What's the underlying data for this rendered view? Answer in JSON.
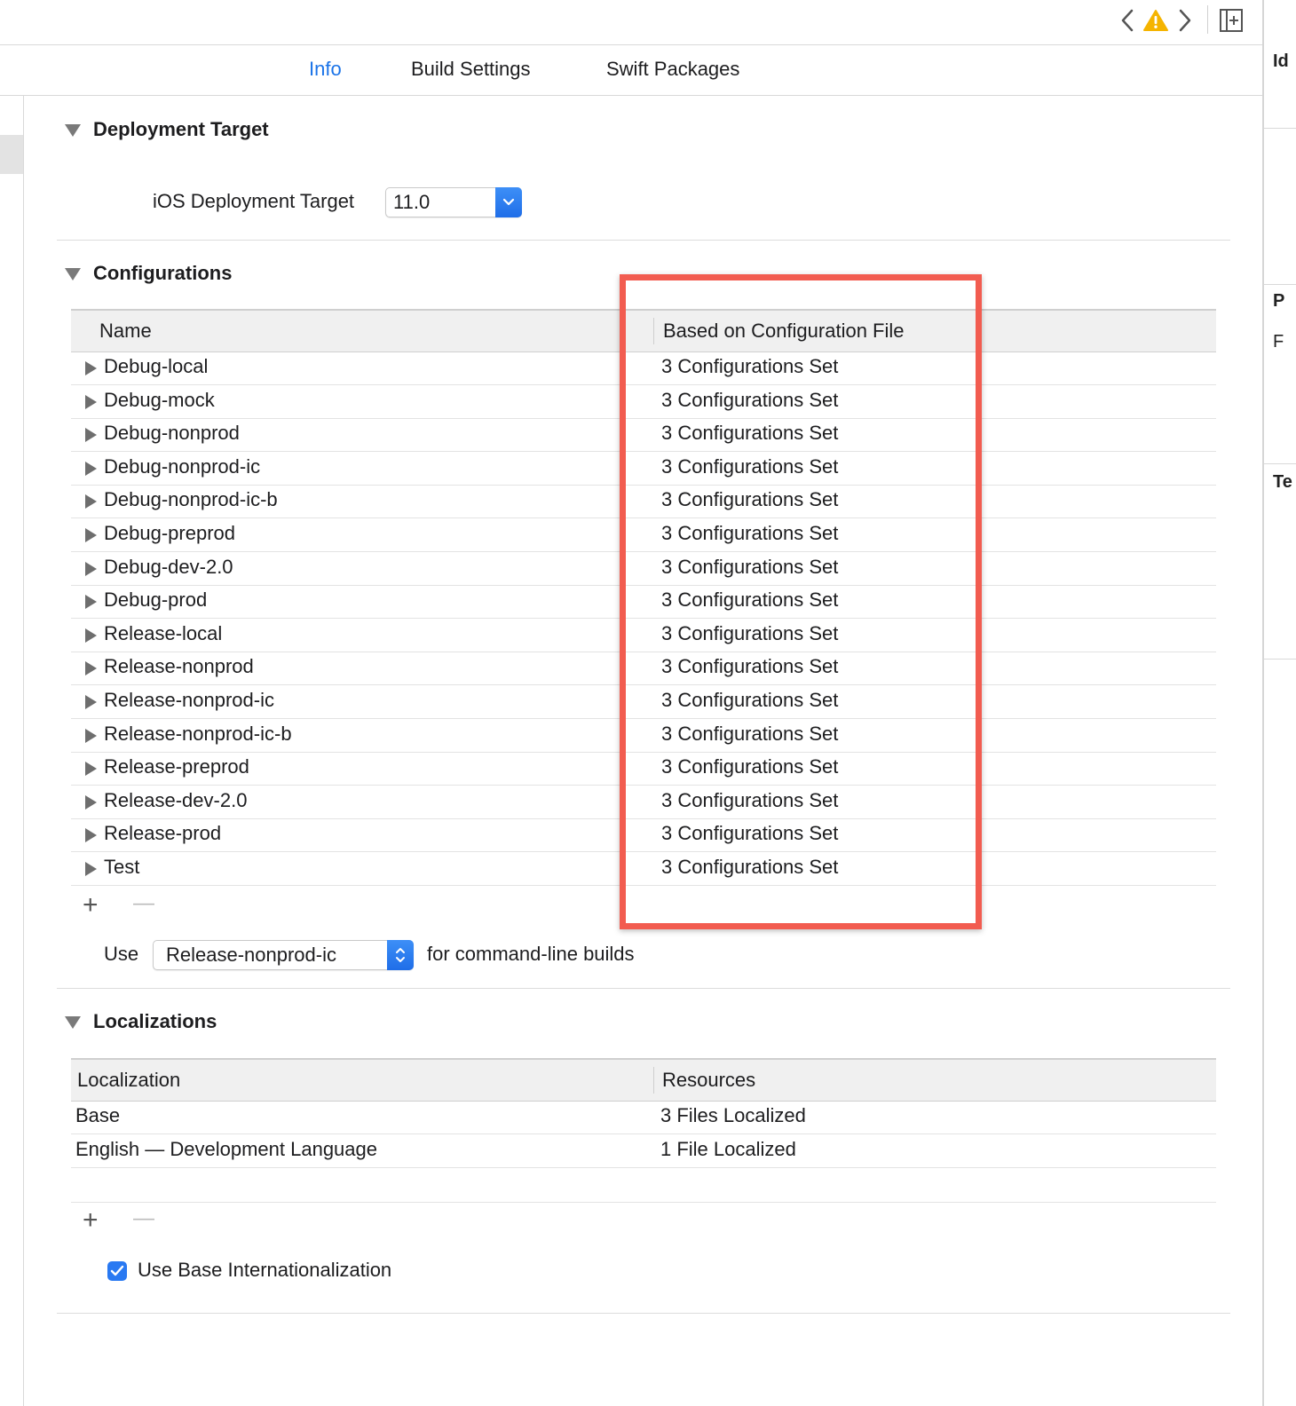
{
  "toolbar": {
    "back_icon": "chevron-left-icon",
    "warning_icon": "warning-icon",
    "forward_icon": "chevron-right-icon",
    "add_editor_icon": "add-editor-icon",
    "warning_color": "#f5b400"
  },
  "tabs": [
    {
      "label": "Info",
      "active": true
    },
    {
      "label": "Build Settings",
      "active": false
    },
    {
      "label": "Swift Packages",
      "active": false
    }
  ],
  "right_panel": {
    "text_1": "Id",
    "text_2": "P",
    "text_3": "F",
    "text_4": "Te"
  },
  "deployment": {
    "title": "Deployment Target",
    "label": "iOS Deployment Target",
    "value": "11.0"
  },
  "configurations": {
    "title": "Configurations",
    "col_name": "Name",
    "col_file": "Based on Configuration File",
    "rows": [
      {
        "name": "Debug-local",
        "file": "3 Configurations Set"
      },
      {
        "name": "Debug-mock",
        "file": "3 Configurations Set"
      },
      {
        "name": "Debug-nonprod",
        "file": "3 Configurations Set"
      },
      {
        "name": "Debug-nonprod-ic",
        "file": "3 Configurations Set"
      },
      {
        "name": "Debug-nonprod-ic-b",
        "file": "3 Configurations Set"
      },
      {
        "name": "Debug-preprod",
        "file": "3 Configurations Set"
      },
      {
        "name": "Debug-dev-2.0",
        "file": "3 Configurations Set"
      },
      {
        "name": "Debug-prod",
        "file": "3 Configurations Set"
      },
      {
        "name": "Release-local",
        "file": "3 Configurations Set"
      },
      {
        "name": "Release-nonprod",
        "file": "3 Configurations Set"
      },
      {
        "name": "Release-nonprod-ic",
        "file": "3 Configurations Set"
      },
      {
        "name": "Release-nonprod-ic-b",
        "file": "3 Configurations Set"
      },
      {
        "name": "Release-preprod",
        "file": "3 Configurations Set"
      },
      {
        "name": "Release-dev-2.0",
        "file": "3 Configurations Set"
      },
      {
        "name": "Release-prod",
        "file": "3 Configurations Set"
      },
      {
        "name": "Test",
        "file": "3 Configurations Set"
      }
    ],
    "add_label": "+",
    "remove_label": "—",
    "use_label": "Use",
    "use_value": "Release-nonprod-ic",
    "use_suffix": "for command-line builds"
  },
  "localizations": {
    "title": "Localizations",
    "col_localization": "Localization",
    "col_resources": "Resources",
    "rows": [
      {
        "localization": "Base",
        "resources": "3 Files Localized"
      },
      {
        "localization": "English — Development Language",
        "resources": "1 File Localized"
      }
    ],
    "add_label": "+",
    "remove_label": "—",
    "checkbox_label": "Use Base Internationalization",
    "checkbox_checked": true
  },
  "highlight_color": "#f25c50",
  "accent_color": "#1a73e8"
}
